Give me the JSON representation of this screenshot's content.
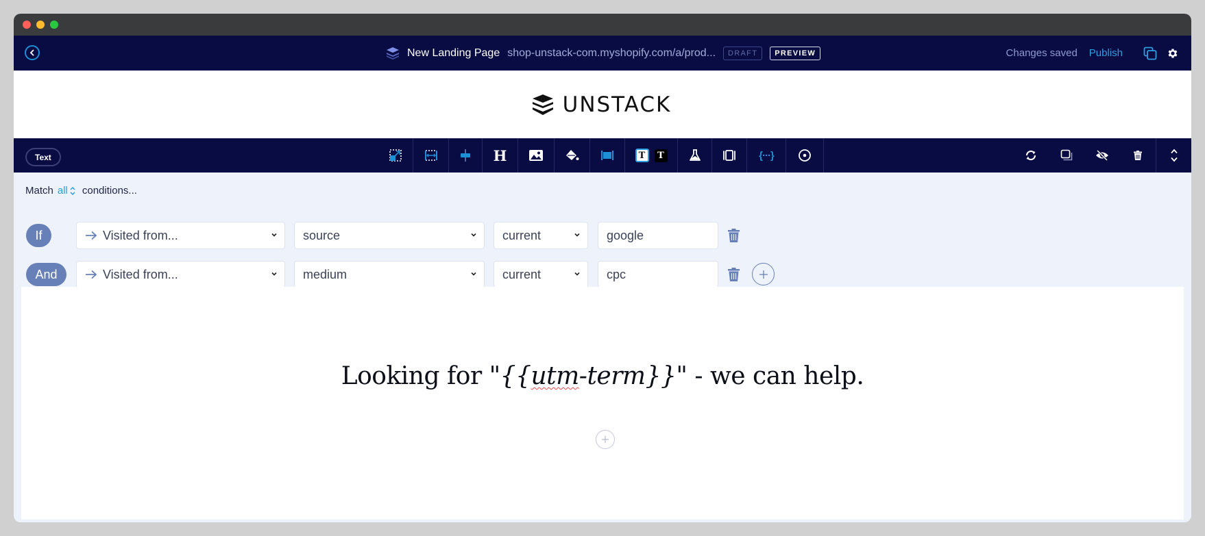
{
  "header": {
    "page_name": "New Landing Page",
    "page_url": "shop-unstack-com.myshopify.com/a/prod...",
    "draft_badge": "DRAFT",
    "preview_button": "PREVIEW",
    "status": "Changes saved",
    "publish_button": "Publish",
    "icons": [
      "back-icon",
      "layers-icon",
      "copy-icon",
      "gear-icon"
    ]
  },
  "logo": {
    "text": "UNSTACK"
  },
  "toolbar": {
    "element_type": "Text",
    "tools": [
      "resize-icon",
      "full-width-icon",
      "align-center-icon",
      "heading-icon",
      "image-icon",
      "fill-icon",
      "layout-icon",
      "text-color-icon",
      "ab-test-icon",
      "padding-icon",
      "dynamic-content-icon",
      "target-icon"
    ],
    "actions": [
      "refresh-icon",
      "duplicate-icon",
      "hide-icon",
      "delete-icon",
      "move-up-icon",
      "move-down-icon"
    ]
  },
  "conditions": {
    "match_prefix": "Match",
    "match_mode": "all",
    "match_suffix": "conditions...",
    "rows": [
      {
        "connector": "If",
        "type": "Visited from...",
        "param": "source",
        "timing": "current",
        "value": "google"
      },
      {
        "connector": "And",
        "type": "Visited from...",
        "param": "medium",
        "timing": "current",
        "value": "cpc"
      }
    ]
  },
  "content": {
    "hero_prefix": "Looking for \"",
    "hero_open": "{{",
    "hero_var": "utm",
    "hero_var_rest": "-term",
    "hero_close": "}}",
    "hero_suffix": "\" - we can help."
  },
  "colors": {
    "nav_bg": "#090c42",
    "accent": "#2d9ee0",
    "pill": "#6780b7",
    "panel_bg": "#edf2fb"
  }
}
